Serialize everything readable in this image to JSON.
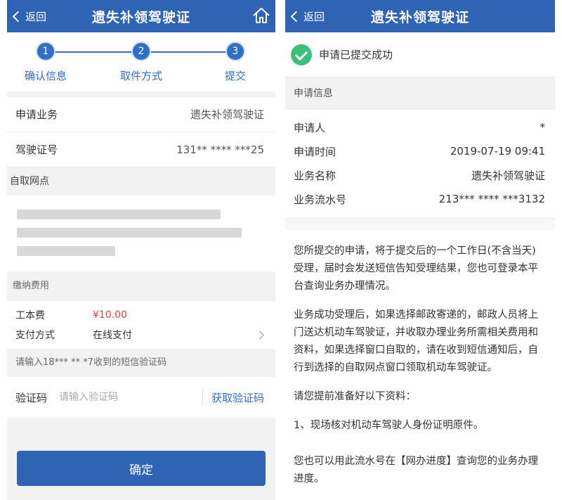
{
  "left": {
    "header": {
      "back_label": "返回",
      "title": "遗失补领驾驶证"
    },
    "steps": [
      {
        "num": "1",
        "label": "确认信息"
      },
      {
        "num": "2",
        "label": "取件方式"
      },
      {
        "num": "3",
        "label": "提交"
      }
    ],
    "business": {
      "label": "申请业务",
      "value": "遗失补领驾驶证"
    },
    "license": {
      "label": "驾驶证号",
      "value": "131** **** ***25"
    },
    "pickup": {
      "title": "自取网点"
    },
    "fees": {
      "title": "缴纳费用",
      "cost_label": "工本费",
      "cost_value": "¥10.00",
      "pay_label": "支付方式",
      "pay_value": "在线支付"
    },
    "sms_hint": "请输入18*** ** *7收到的短信验证码",
    "code": {
      "label": "验证码",
      "placeholder": "请输入验证码",
      "get_label": "获取验证码"
    },
    "confirm_label": "确定"
  },
  "right": {
    "header": {
      "back_label": "返回",
      "title": "遗失补领驾驶证"
    },
    "success_text": "申请已提交成功",
    "info_title": "申请信息",
    "info": [
      {
        "label": "申请人",
        "value": "*"
      },
      {
        "label": "申请时间",
        "value": "2019-07-19 09:41"
      },
      {
        "label": "业务名称",
        "value": "遗失补领驾驶证"
      },
      {
        "label": "业务流水号",
        "value": "213*** **** ***3132"
      }
    ],
    "notes": [
      "您所提交的申请，将于提交后的一个工作日(不含当天)受理，届时会发送短信告知受理结果，您也可登录本平台查询业务办理情况。",
      "业务成功受理后，如果选择邮政寄递的，邮政人员将上门送达机动车驾驶证，并收取办理业务所需相关费用和资料，如果选择窗口自取的，请在收到短信通知后，自行到选择的自取网点窗口领取机动车驾驶证。",
      "请您提前准备好以下资料：",
      "1、现场核对机动车驾驶人身份证明原件。",
      "您也可以用此流水号在【网办进度】查询您的业务办理进度。"
    ]
  },
  "colors": {
    "primary": "#2f64b4",
    "accent": "#2f6fc8",
    "price": "#e0433a",
    "success": "#3cbf7a"
  }
}
